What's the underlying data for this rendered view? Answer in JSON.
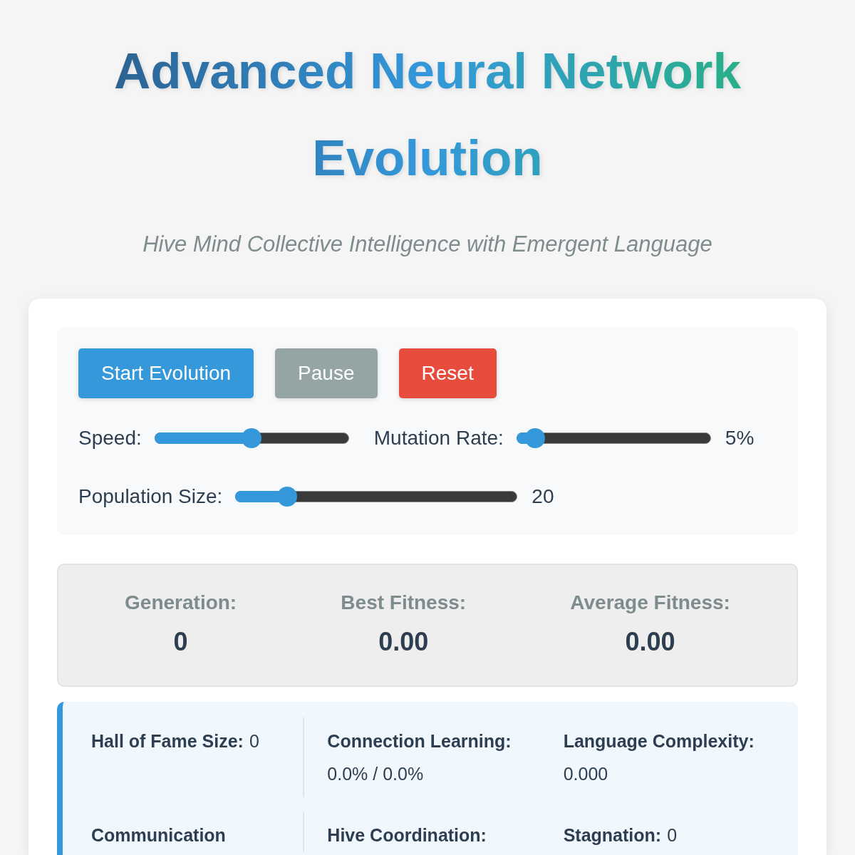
{
  "header": {
    "title": "Advanced Neural Network Evolution",
    "subtitle": "Hive Mind Collective Intelligence with Emergent Language"
  },
  "controls": {
    "buttons": [
      {
        "label": "Start Evolution",
        "kind": "start"
      },
      {
        "label": "Pause",
        "kind": "pause"
      },
      {
        "label": "Reset",
        "kind": "reset"
      }
    ],
    "slider_rows": [
      [
        {
          "label": "Speed:",
          "level": 0.5
        },
        {
          "label": "Mutation Rate:",
          "level": 0.05,
          "reading": "5%"
        }
      ],
      [
        {
          "label": "Population Size:",
          "level": 0.16,
          "reading": "20"
        }
      ]
    ]
  },
  "stats": [
    {
      "label": "Generation:",
      "value": "0"
    },
    {
      "label": "Best Fitness:",
      "value": "0.00"
    },
    {
      "label": "Average Fitness:",
      "value": "0.00"
    }
  ],
  "metrics": [
    [
      {
        "label": "Hall of Fame Size:",
        "value": "0"
      },
      {
        "label": "Connection Learning:",
        "value": "0.0% / 0.0%"
      },
      {
        "label": "Language Complexity:",
        "value": "0.000"
      }
    ],
    [
      {
        "label": "Communication"
      },
      {
        "label": "Hive Coordination:"
      },
      {
        "label": "Stagnation:",
        "value": "0"
      }
    ]
  ]
}
